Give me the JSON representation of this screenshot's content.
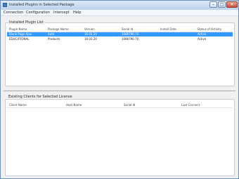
{
  "window": {
    "title": "Installed Plugins in Selected Package"
  },
  "menu": [
    "Connection",
    "Configuration",
    "Intercept",
    "Help"
  ],
  "installed_panel": {
    "title": "Installed Plugin List",
    "columns": [
      "Plugin Name",
      "Package Name",
      "Version",
      "Serial Id",
      "Install Date",
      "Status of Activity"
    ],
    "rows": [
      [
        "Blank Page Ajax",
        "Auth",
        "16.03.20",
        "1086790.70",
        "",
        "Active"
      ],
      [
        "EDUCATIONAL",
        "Products",
        "16.03.20",
        "1086790.70",
        "",
        "Active"
      ]
    ]
  },
  "clients_panel": {
    "title": "Existing Clients for Selected License",
    "columns": [
      "Client Name",
      "Host Name",
      "Serial Id",
      "Last Connect"
    ]
  }
}
